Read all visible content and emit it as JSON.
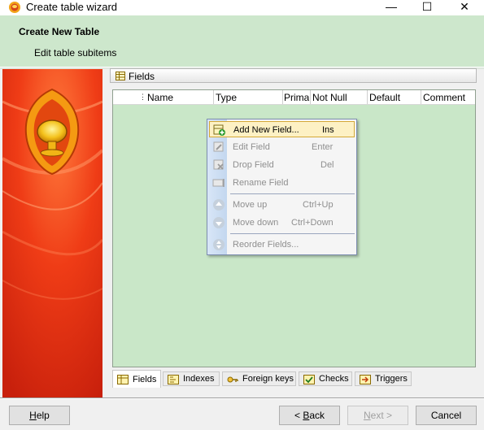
{
  "window": {
    "title": "Create table wizard",
    "minimize_glyph": "—",
    "maximize_glyph": "☐",
    "close_glyph": "✕"
  },
  "header": {
    "title": "Create New Table",
    "subtitle": "Edit table subitems"
  },
  "section": {
    "label": "Fields",
    "icon": "table-icon"
  },
  "grid": {
    "columns": [
      "Name",
      "Type",
      "Primar",
      "Not Null",
      "Default",
      "Comment"
    ]
  },
  "context_menu": {
    "items": [
      {
        "label": "Add New Field...",
        "shortcut": "Ins",
        "icon": "add-field-icon",
        "enabled": true
      },
      {
        "label": "Edit Field",
        "shortcut": "Enter",
        "icon": "edit-field-icon",
        "enabled": false
      },
      {
        "label": "Drop Field",
        "shortcut": "Del",
        "icon": "drop-field-icon",
        "enabled": false
      },
      {
        "label": "Rename Field",
        "shortcut": "",
        "icon": "rename-field-icon",
        "enabled": false
      },
      {
        "label": "Move up",
        "shortcut": "Ctrl+Up",
        "icon": "move-up-icon",
        "enabled": false
      },
      {
        "label": "Move down",
        "shortcut": "Ctrl+Down",
        "icon": "move-down-icon",
        "enabled": false
      },
      {
        "label": "Reorder Fields...",
        "shortcut": "",
        "icon": "reorder-icon",
        "enabled": false
      }
    ]
  },
  "tabs": [
    {
      "label": "Fields",
      "icon": "fields-tab-icon",
      "active": true
    },
    {
      "label": "Indexes",
      "icon": "indexes-tab-icon",
      "active": false
    },
    {
      "label": "Foreign keys",
      "icon": "key-icon",
      "active": false
    },
    {
      "label": "Checks",
      "icon": "check-icon",
      "active": false
    },
    {
      "label": "Triggers",
      "icon": "trigger-icon",
      "active": false
    }
  ],
  "buttons": {
    "help_accel": "H",
    "help_rest": "elp",
    "back_prefix": "< ",
    "back_accel": "B",
    "back_rest": "ack",
    "next_accel": "N",
    "next_rest": "ext >",
    "cancel": "Cancel"
  },
  "colors": {
    "header_bg": "#cde7cc",
    "grid_bg": "#c9e7c8",
    "banner_red": "#e8401a",
    "menu_highlight": "#fdf1c4"
  }
}
